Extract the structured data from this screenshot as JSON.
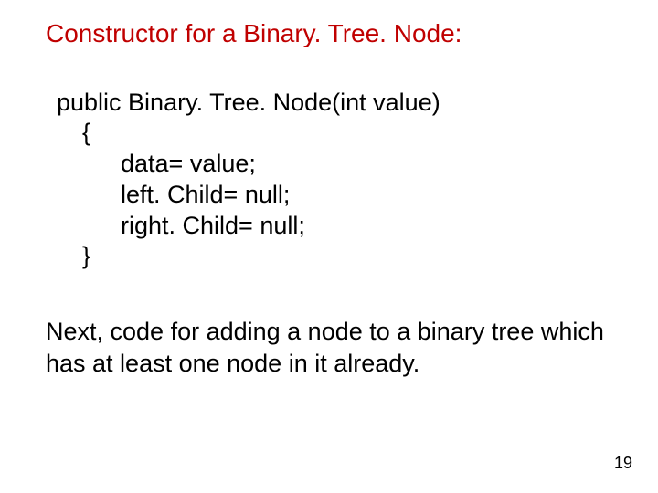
{
  "title": "Constructor for a Binary. Tree. Node:",
  "code": {
    "l1": "public Binary. Tree. Node(int value)",
    "l2": "{",
    "l3": "data= value;",
    "l4": "left. Child= null;",
    "l5": "right. Child= null;",
    "l6": "}"
  },
  "body": "Next, code for adding a node to a binary tree which has at least one node in it already.",
  "page_number": "19"
}
